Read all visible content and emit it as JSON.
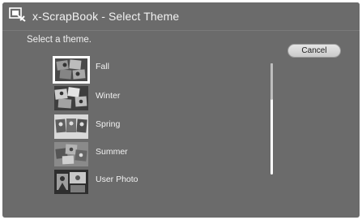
{
  "window": {
    "title": "x-ScrapBook - Select Theme",
    "icon": "scrapbook-app-icon"
  },
  "prompt": "Select a theme.",
  "cancel_label": "Cancel",
  "themes": [
    {
      "label": "Fall",
      "selected": true,
      "thumbnail": "fall-thumbnail"
    },
    {
      "label": "Winter",
      "selected": false,
      "thumbnail": "winter-thumbnail"
    },
    {
      "label": "Spring",
      "selected": false,
      "thumbnail": "spring-thumbnail"
    },
    {
      "label": "Summer",
      "selected": false,
      "thumbnail": "summer-thumbnail"
    },
    {
      "label": "User Photo",
      "selected": false,
      "thumbnail": "user-photo-thumbnail"
    }
  ],
  "colors": {
    "background": "#6b6b6b",
    "text": "#f2f2f2",
    "selection_border": "#ffffff"
  }
}
